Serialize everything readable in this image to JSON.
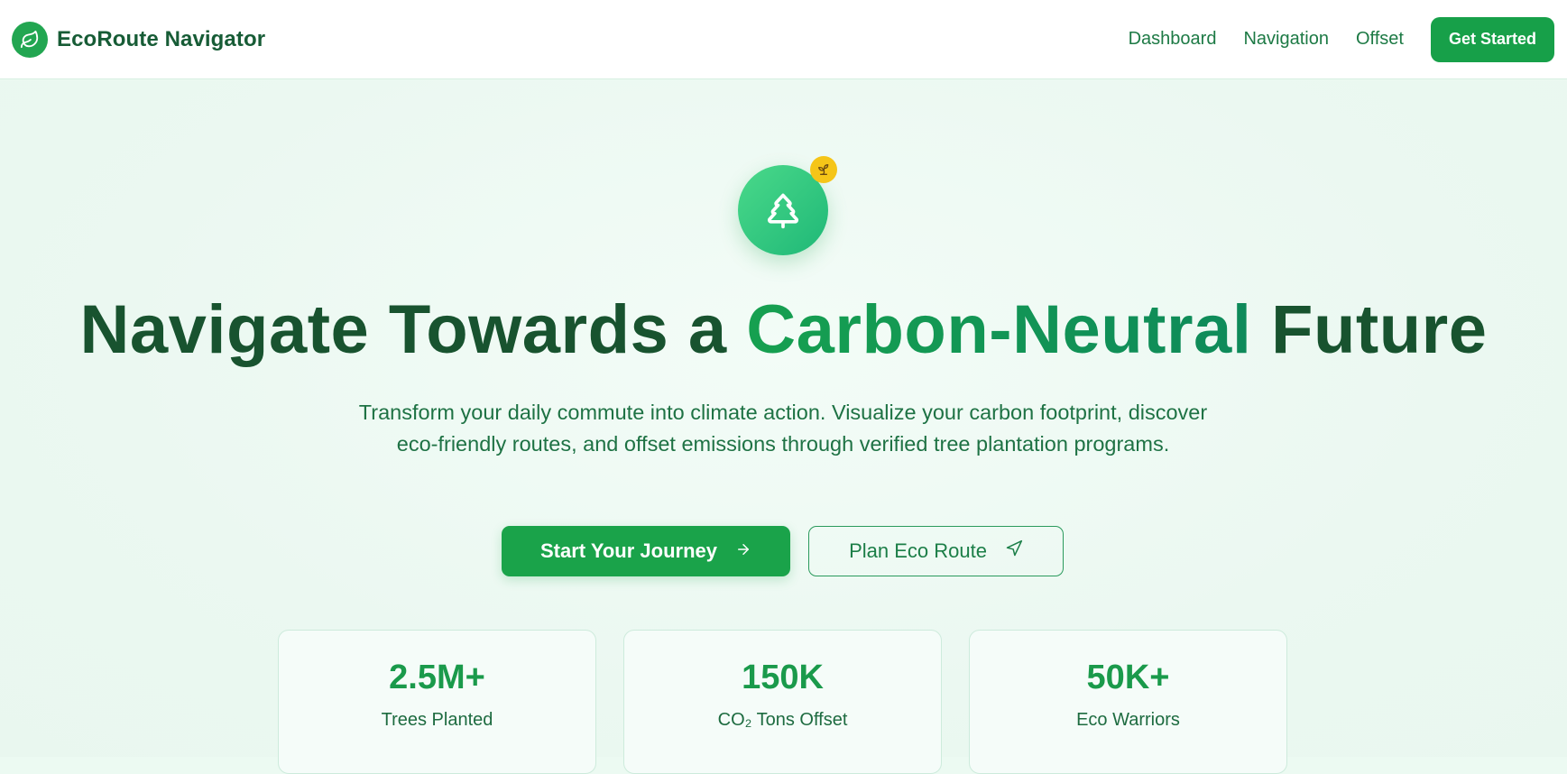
{
  "header": {
    "brand_name": "EcoRoute Navigator",
    "brand_icon": "leaf-icon",
    "nav": [
      {
        "label": "Dashboard"
      },
      {
        "label": "Navigation"
      },
      {
        "label": "Offset"
      }
    ],
    "cta_label": "Get Started"
  },
  "hero": {
    "icon": "tree-icon",
    "badge_icon": "sprout-icon",
    "headline_before": "Navigate Towards a ",
    "headline_accent": "Carbon-Neutral",
    "headline_after": " Future",
    "subtitle": "Transform your daily commute into climate action. Visualize your carbon footprint, discover eco-friendly routes, and offset emissions through verified tree plantation programs.",
    "primary_button": {
      "label": "Start Your Journey",
      "icon": "arrow-right-icon"
    },
    "secondary_button": {
      "label": "Plan Eco Route",
      "icon": "send-icon"
    }
  },
  "stats": [
    {
      "value": "2.5M+",
      "label": "Trees Planted"
    },
    {
      "value": "150K",
      "label": "CO₂ Tons Offset"
    },
    {
      "value": "50K+",
      "label": "Eco Warriors"
    }
  ],
  "colors": {
    "brand_green": "#17a049",
    "dark_green": "#18532f",
    "accent_gradient_start": "#16a050",
    "accent_gradient_end": "#0e8a5a",
    "badge_yellow": "#f5c518",
    "background": "#ecfaf2"
  }
}
